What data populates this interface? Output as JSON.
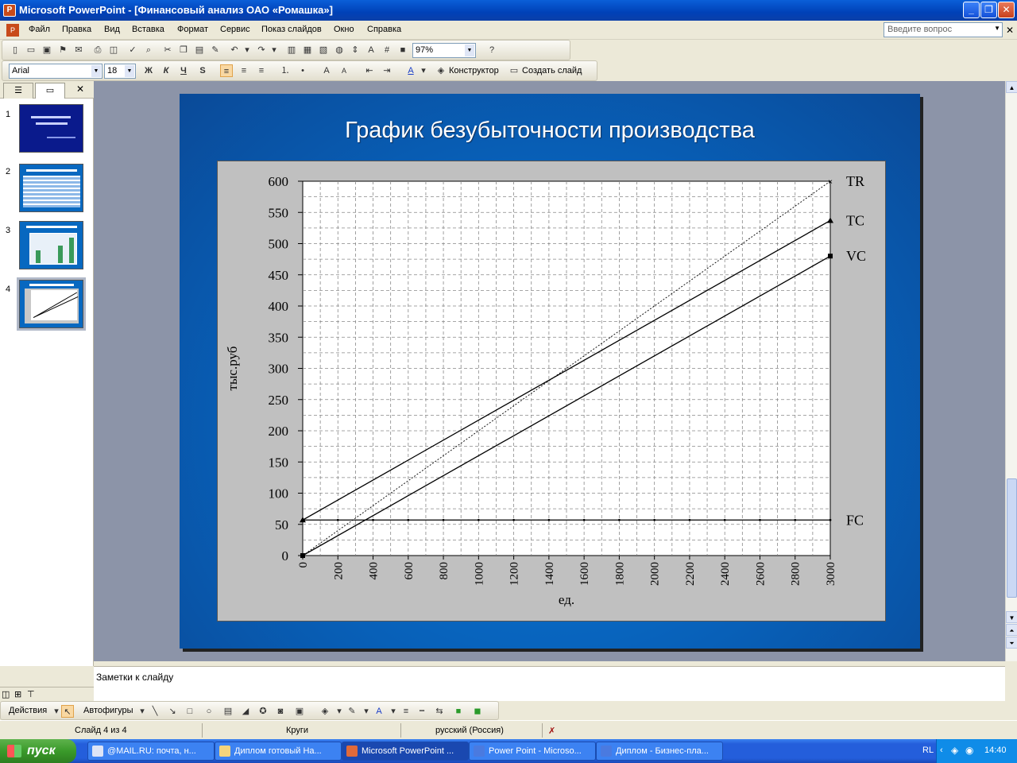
{
  "window": {
    "title": "Microsoft PowerPoint - [Финансовый анализ ОАО «Ромашка»]"
  },
  "menu": {
    "items": [
      "Файл",
      "Правка",
      "Вид",
      "Вставка",
      "Формат",
      "Сервис",
      "Показ слайдов",
      "Окно",
      "Справка"
    ],
    "help_placeholder": "Введите вопрос"
  },
  "standard_toolbar": {
    "zoom": "97%"
  },
  "format_toolbar": {
    "font": "Arial",
    "size": "18",
    "bold": "Ж",
    "italic": "К",
    "underline": "Ч",
    "shadow": "S",
    "designer": "Конструктор",
    "new_slide": "Создать слайд"
  },
  "slides_pane": {
    "numbers": [
      "1",
      "2",
      "3",
      "4"
    ],
    "selected": 4
  },
  "slide": {
    "title": "График безубыточности производства"
  },
  "chart_data": {
    "type": "line",
    "ylabel": "тыс.руб",
    "xlabel": "ед.",
    "ylim": [
      0,
      600
    ],
    "xlim": [
      0,
      3000
    ],
    "yticks": [
      "0",
      "50",
      "100",
      "150",
      "200",
      "250",
      "300",
      "350",
      "400",
      "450",
      "500",
      "550",
      "600"
    ],
    "xticks": [
      "0",
      "200",
      "400",
      "600",
      "800",
      "1000",
      "1200",
      "1400",
      "1600",
      "1800",
      "2000",
      "2200",
      "2400",
      "2600",
      "2800",
      "3000"
    ],
    "grid": true,
    "series": [
      {
        "name": "TR",
        "x": [
          0,
          3000
        ],
        "y": [
          0,
          600
        ],
        "style": "dotted"
      },
      {
        "name": "TC",
        "x": [
          0,
          3000
        ],
        "y": [
          57,
          537
        ],
        "style": "solid"
      },
      {
        "name": "VC",
        "x": [
          0,
          3000
        ],
        "y": [
          0,
          480
        ],
        "style": "solid"
      },
      {
        "name": "FC",
        "x": [
          0,
          3000
        ],
        "y": [
          57,
          57
        ],
        "style": "solid"
      }
    ]
  },
  "notes": {
    "placeholder": "Заметки к слайду"
  },
  "draw_toolbar": {
    "actions": "Действия",
    "autoshapes": "Автофигуры"
  },
  "status": {
    "slide": "Слайд 4 из 4",
    "design": "Круги",
    "language": "русский (Россия)"
  },
  "taskbar": {
    "start": "пуск",
    "tasks": [
      "@MAIL.RU: почта, н...",
      "Диплом готовый На...",
      "Microsoft PowerPoint ...",
      "Power Point - Microso...",
      "Диплом - Бизнес-пла..."
    ],
    "lang": "RL",
    "time": "14:40"
  }
}
